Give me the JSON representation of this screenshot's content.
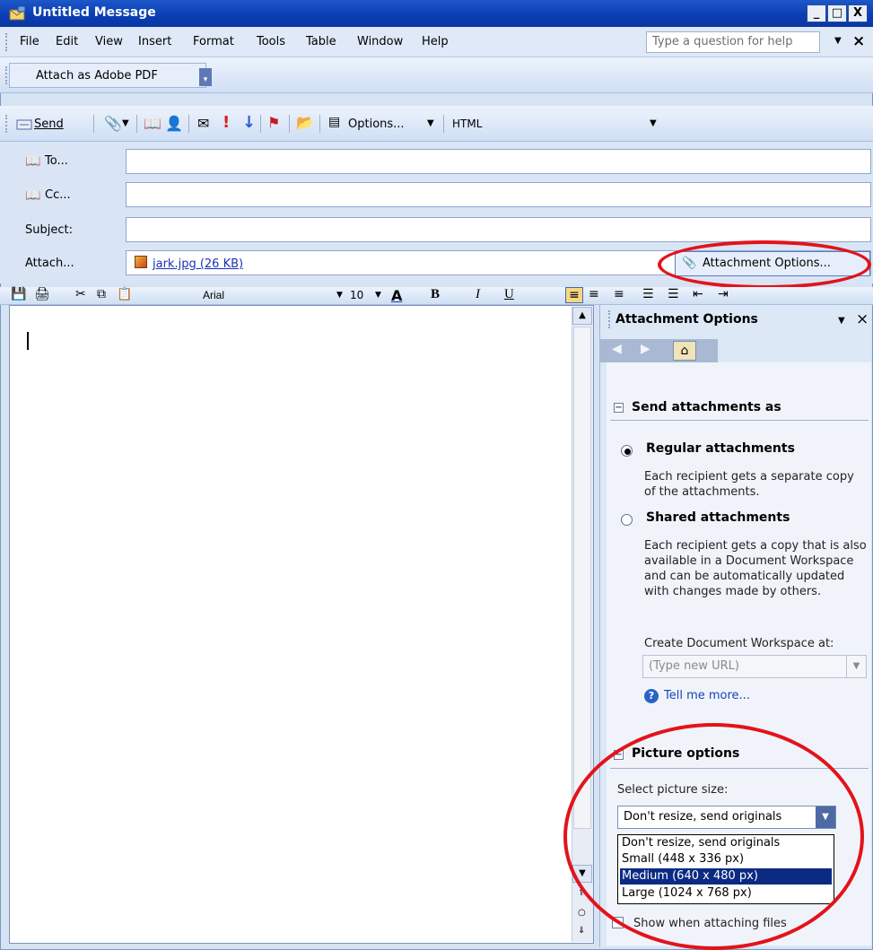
{
  "window": {
    "title": "Untitled Message",
    "min": "_",
    "max": "□",
    "close": "X"
  },
  "menu": {
    "items": [
      "File",
      "Edit",
      "View",
      "Insert",
      "Format",
      "Tools",
      "Table",
      "Window",
      "Help"
    ],
    "help_placeholder": "Type a question for help",
    "close": "×"
  },
  "pdf_toolbar": {
    "label": "Attach as Adobe PDF"
  },
  "std_toolbar": {
    "send": "Send",
    "options": "Options...",
    "format": "HTML"
  },
  "header": {
    "to_label": "To...",
    "cc_label": "Cc...",
    "subject_label": "Subject:",
    "attach_label": "Attach...",
    "attachment_name": "jark.jpg (26 KB)",
    "attach_options_button": "Attachment Options..."
  },
  "format_toolbar": {
    "font": "Arial",
    "size": "10",
    "bold": "B",
    "italic": "I",
    "underline": "U",
    "font_color": "A"
  },
  "pane": {
    "title": "Attachment Options",
    "close": "×",
    "section1": "Send attachments as",
    "regular_label": "Regular attachments",
    "regular_desc": "Each recipient gets a separate copy of the attachments.",
    "shared_label": "Shared attachments",
    "shared_desc": "Each recipient gets a copy that is also available in a Document Workspace and can be automatically updated with changes made by others.",
    "workspace_label": "Create Document Workspace at:",
    "workspace_placeholder": "(Type new URL)",
    "tell_more": "Tell me more...",
    "section2": "Picture options",
    "size_label": "Select picture size:",
    "size_selected": "Don't resize, send originals",
    "size_options": [
      "Don't resize, send originals",
      "Small (448 x 336 px)",
      "Medium (640 x 480 px)",
      "Large (1024 x 768 px)"
    ],
    "show_when_attaching": "Show when attaching files"
  },
  "colors": {
    "accent_ring": "#e3131b",
    "titlebar": "#0b3fb4",
    "selection": "#0b2b83"
  }
}
